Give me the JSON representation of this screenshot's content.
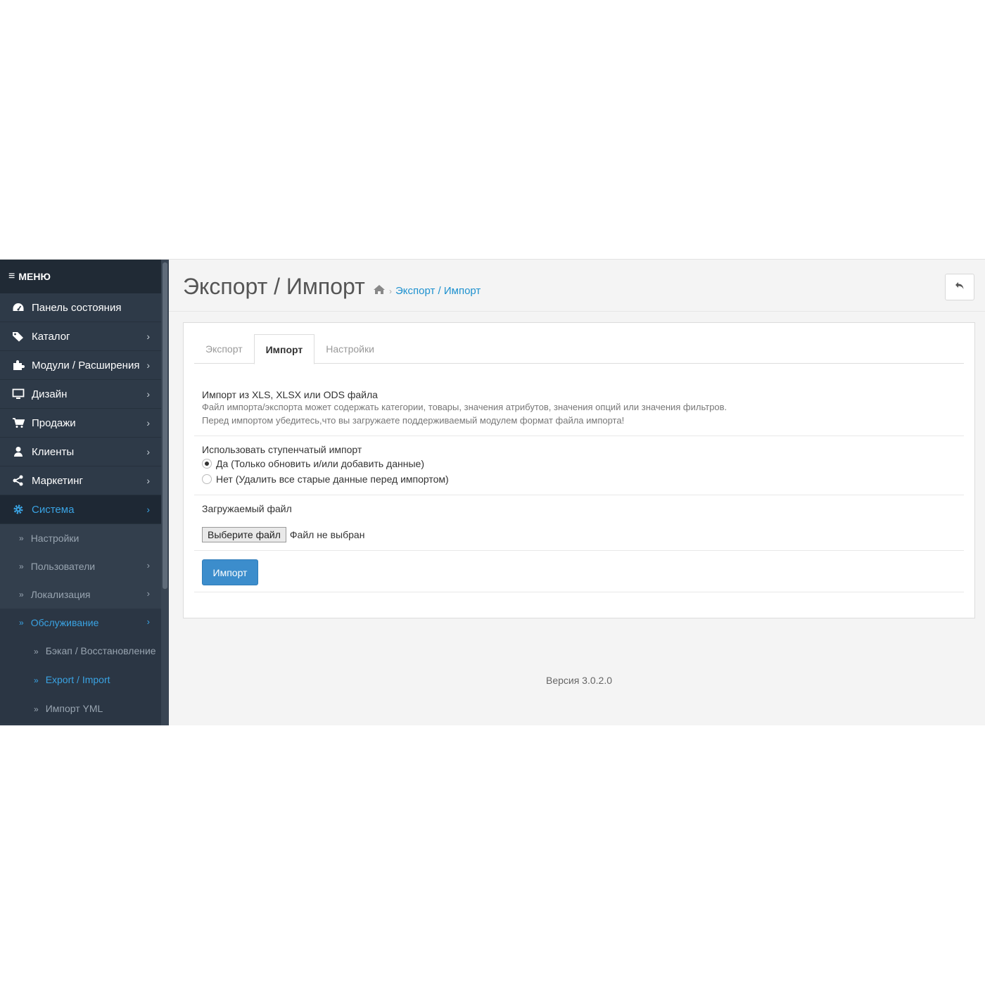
{
  "sidebar": {
    "menu_label": "МЕНЮ",
    "items": [
      {
        "label": "Панель состояния",
        "icon": "dashboard-icon",
        "chevron": false
      },
      {
        "label": "Каталог",
        "icon": "tags-icon",
        "chevron": true
      },
      {
        "label": "Модули / Расширения",
        "icon": "puzzle-icon",
        "chevron": true
      },
      {
        "label": "Дизайн",
        "icon": "desktop-icon",
        "chevron": true
      },
      {
        "label": "Продажи",
        "icon": "cart-icon",
        "chevron": true
      },
      {
        "label": "Клиенты",
        "icon": "user-icon",
        "chevron": true
      },
      {
        "label": "Маркетинг",
        "icon": "share-icon",
        "chevron": true
      },
      {
        "label": "Система",
        "icon": "gear-icon",
        "chevron": true,
        "active": true
      }
    ],
    "sub_items": [
      {
        "label": "Настройки"
      },
      {
        "label": "Пользователи"
      },
      {
        "label": "Локализация"
      },
      {
        "label": "Обслуживание"
      }
    ],
    "subsub_items": [
      {
        "label": "Бэкап / Восстановление"
      },
      {
        "label": "Export / Import"
      },
      {
        "label": "Импорт YML"
      }
    ]
  },
  "header": {
    "title": "Экспорт / Импорт",
    "breadcrumb_link": "Экспорт / Импорт"
  },
  "tabs": [
    "Экспорт",
    "Импорт",
    "Настройки"
  ],
  "import": {
    "title": "Импорт из XLS, XLSX или ODS файла",
    "desc1": "Файл импорта/экспорта может содержать категории, товары, значения атрибутов, значения опций или значения фильтров.",
    "desc2": "Перед импортом убедитесь,что вы загружаете поддерживаемый модулем формат файла импорта!"
  },
  "incremental": {
    "title": "Использовать ступенчатый импорт",
    "option_yes": "Да (Только обновить и/или добавить данные)",
    "option_no": "Нет (Удалить все старые данные перед импортом)"
  },
  "upload": {
    "title": "Загружаемый файл",
    "choose_label": "Выберите файл",
    "no_file": "Файл не выбран"
  },
  "import_button": "Импорт",
  "footer": {
    "version": "Версия 3.0.2.0"
  },
  "colors": {
    "accent": "#1e91cf",
    "sidebar_bg": "#2e3a48",
    "button": "#3c8dcc"
  }
}
